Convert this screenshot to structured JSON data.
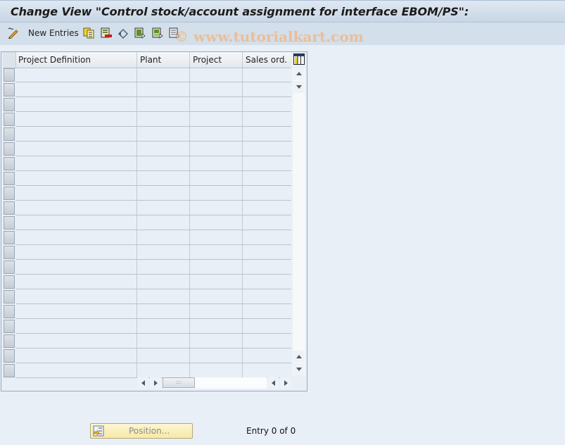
{
  "window": {
    "title": "Change View \"Control stock/account assignment for interface EBOM/PS\":"
  },
  "toolbar": {
    "items": [
      {
        "icon": "edit-toggle-icon"
      },
      {
        "label": "New Entries"
      },
      {
        "icon": "copy-as-icon"
      },
      {
        "icon": "delete-icon"
      },
      {
        "icon": "undo-change-icon"
      },
      {
        "icon": "select-all-icon"
      },
      {
        "icon": "select-block-icon"
      },
      {
        "icon": "deselect-all-icon"
      }
    ]
  },
  "watermark": "© www.tutorialkart.com",
  "table": {
    "columns": [
      "Project Definition",
      "Plant",
      "Project",
      "Sales ord."
    ],
    "row_count": 21,
    "rows": []
  },
  "footer": {
    "position_button": "Position...",
    "entry_info": "Entry 0 of 0"
  },
  "colors": {
    "background": "#e9eff6",
    "toolbar": "#d3dfea",
    "position_button": "#f7e9a6"
  }
}
